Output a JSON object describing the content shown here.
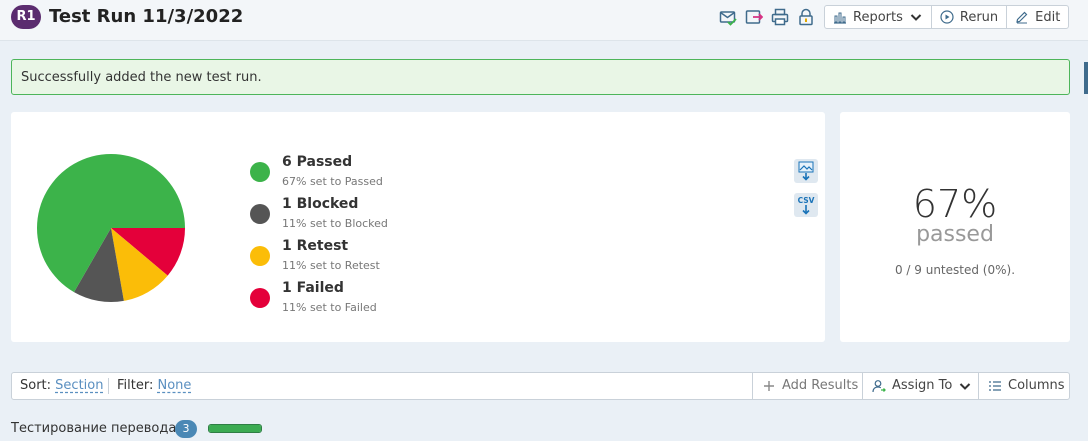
{
  "header": {
    "badge": "R1",
    "title": "Test Run 11/3/2022",
    "icons": [
      "mail-check-icon",
      "export-icon",
      "print-icon",
      "lock-icon"
    ],
    "buttons": {
      "reports": "Reports",
      "rerun": "Rerun",
      "edit": "Edit"
    }
  },
  "message": {
    "text": "Successfully added the new test run."
  },
  "chart_data": {
    "type": "pie",
    "labels": [
      "Passed",
      "Blocked",
      "Retest",
      "Failed"
    ],
    "values": [
      6,
      1,
      1,
      1
    ],
    "colors": [
      "#3cb34a",
      "#555555",
      "#fbbd08",
      "#e4003a"
    ],
    "legend": [
      {
        "main": "6 Passed",
        "sub": "67% set to Passed"
      },
      {
        "main": "1 Blocked",
        "sub": "11% set to Blocked"
      },
      {
        "main": "1 Retest",
        "sub": "11% set to Retest"
      },
      {
        "main": "1 Failed",
        "sub": "11% set to Failed"
      }
    ]
  },
  "exports": {
    "csv_label": "CSV"
  },
  "stats": {
    "percent": "67%",
    "label": "passed",
    "untested": "0 / 9 untested (0%)."
  },
  "toolbar": {
    "sort_label": "Sort:",
    "sort_value": "Section",
    "filter_label": "Filter:",
    "filter_value": "None",
    "add_results": "Add Results",
    "assign_to": "Assign To",
    "columns": "Columns"
  },
  "section": {
    "title": "Тестирование перевода",
    "count": "3",
    "progress_fraction": 1.0
  }
}
